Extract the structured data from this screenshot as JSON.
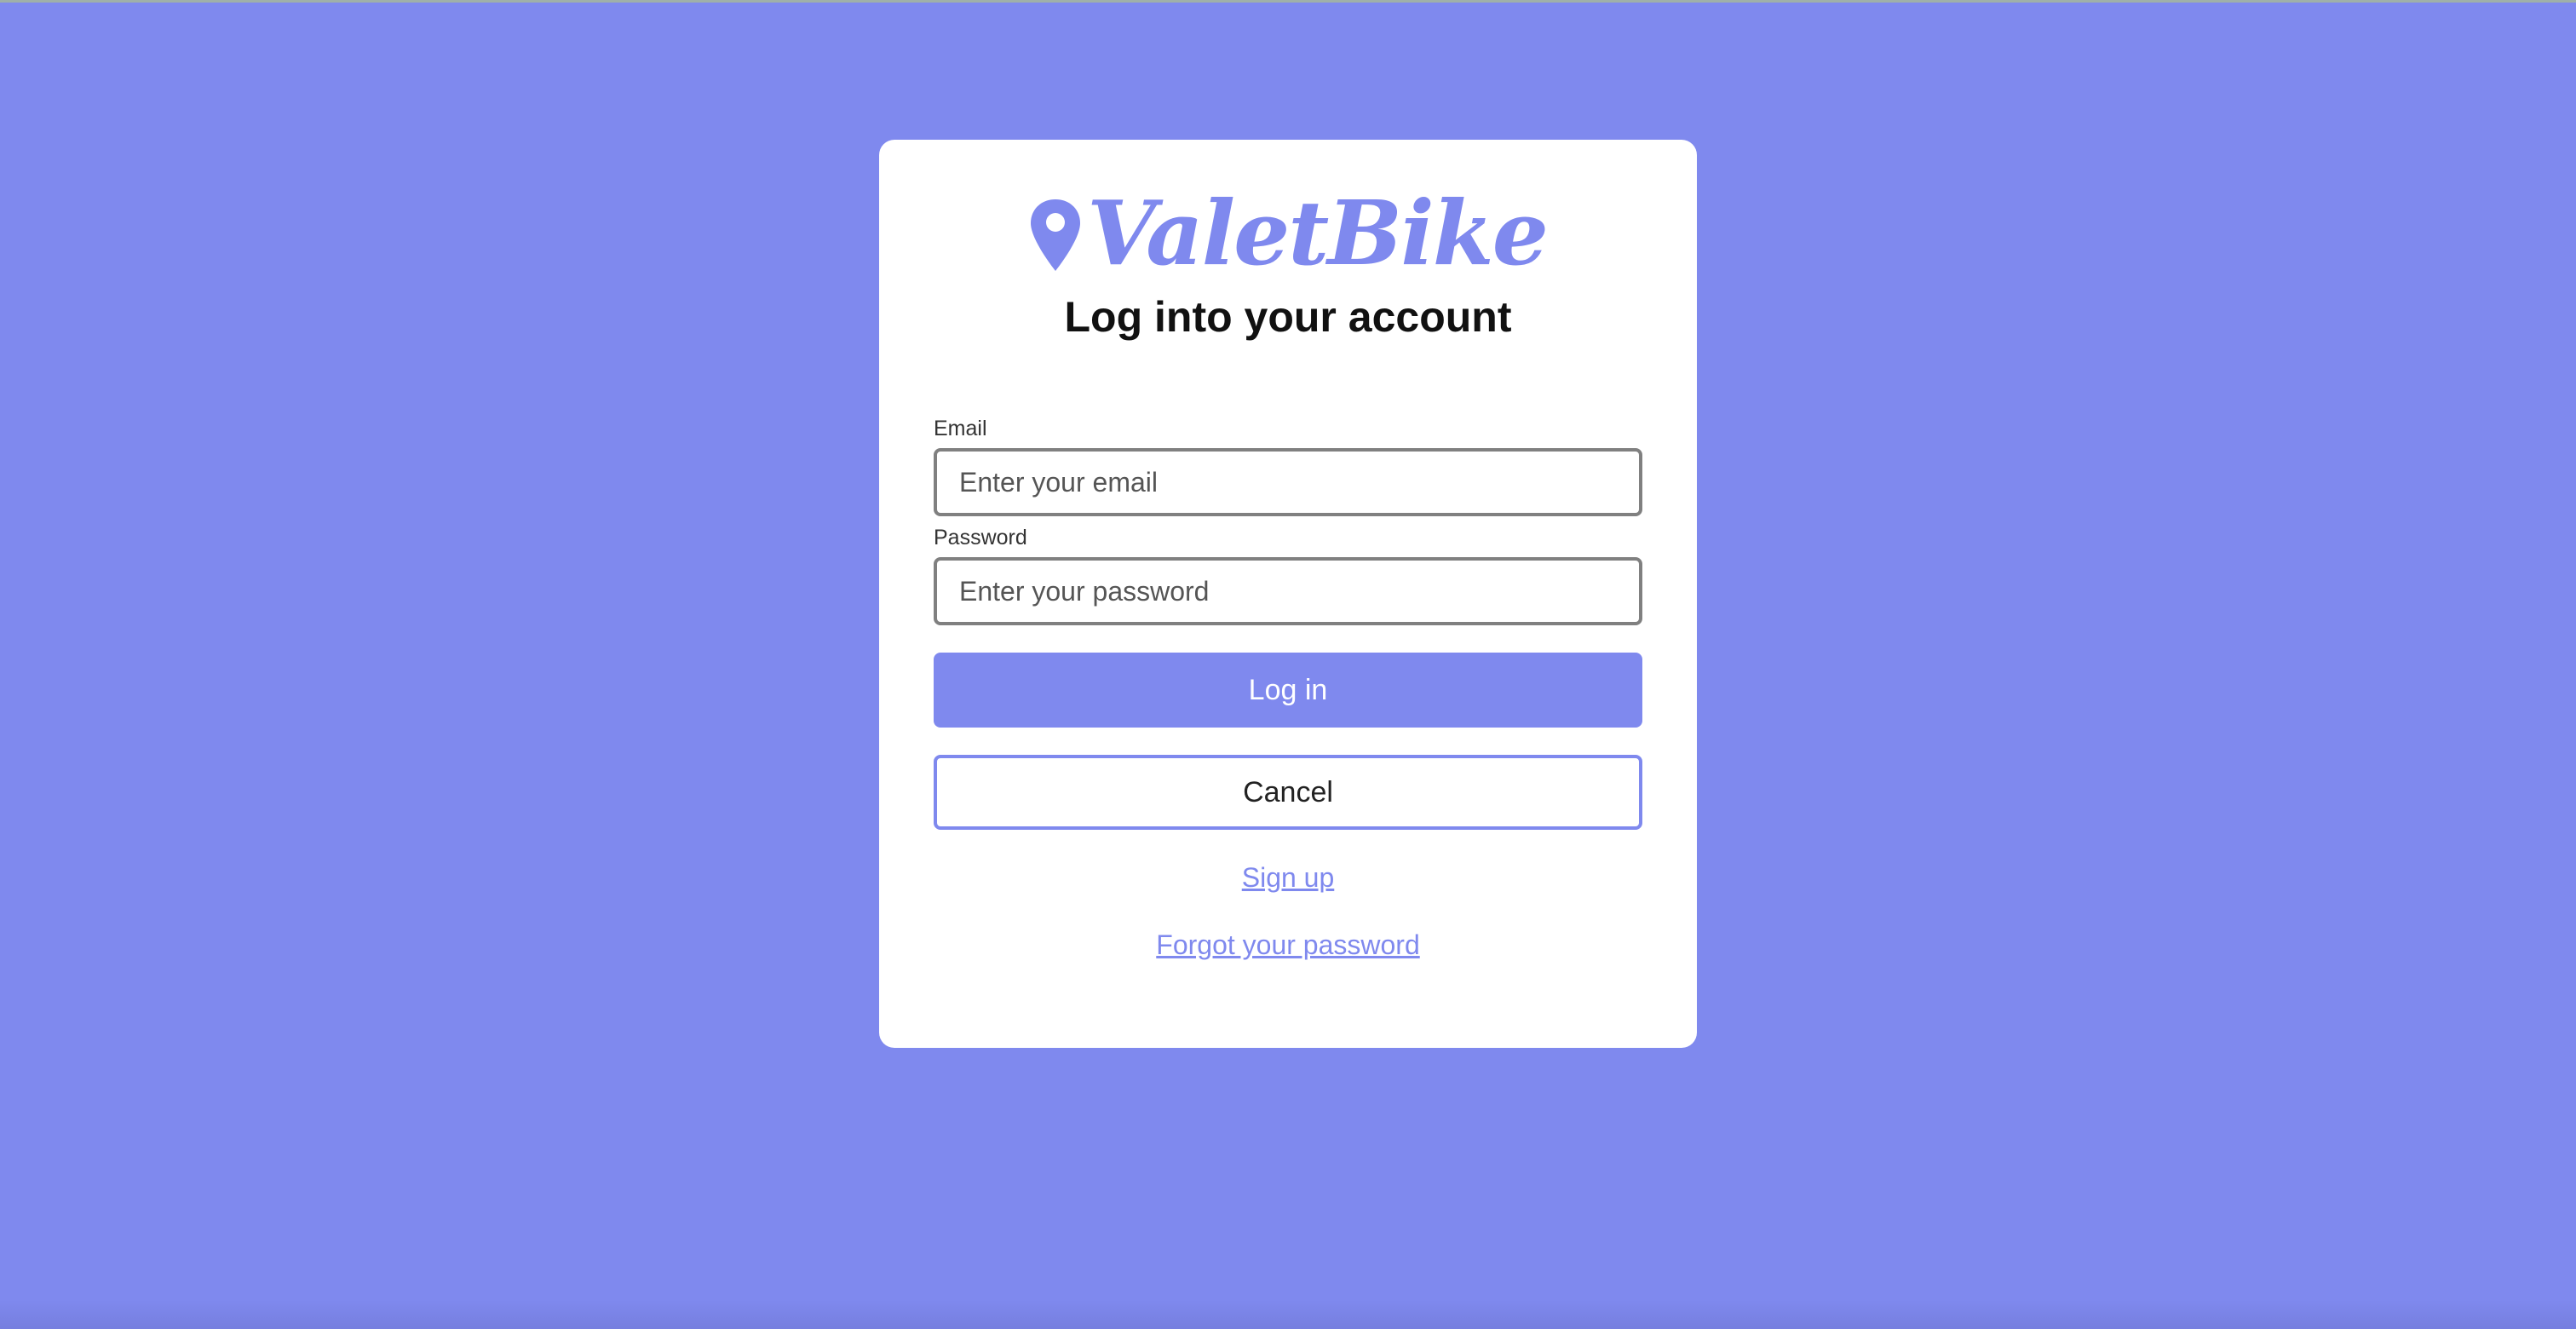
{
  "brand": {
    "name": "ValetBike",
    "icon": "map-pin-icon",
    "color": "#7f89ee"
  },
  "page": {
    "background": "#7f89ee",
    "title": "Log into your account"
  },
  "form": {
    "email": {
      "label": "Email",
      "placeholder": "Enter your email",
      "value": ""
    },
    "password": {
      "label": "Password",
      "placeholder": "Enter your password",
      "value": ""
    },
    "login_label": "Log in",
    "cancel_label": "Cancel"
  },
  "links": {
    "signup": "Sign up",
    "forgot_password": "Forgot your password"
  }
}
